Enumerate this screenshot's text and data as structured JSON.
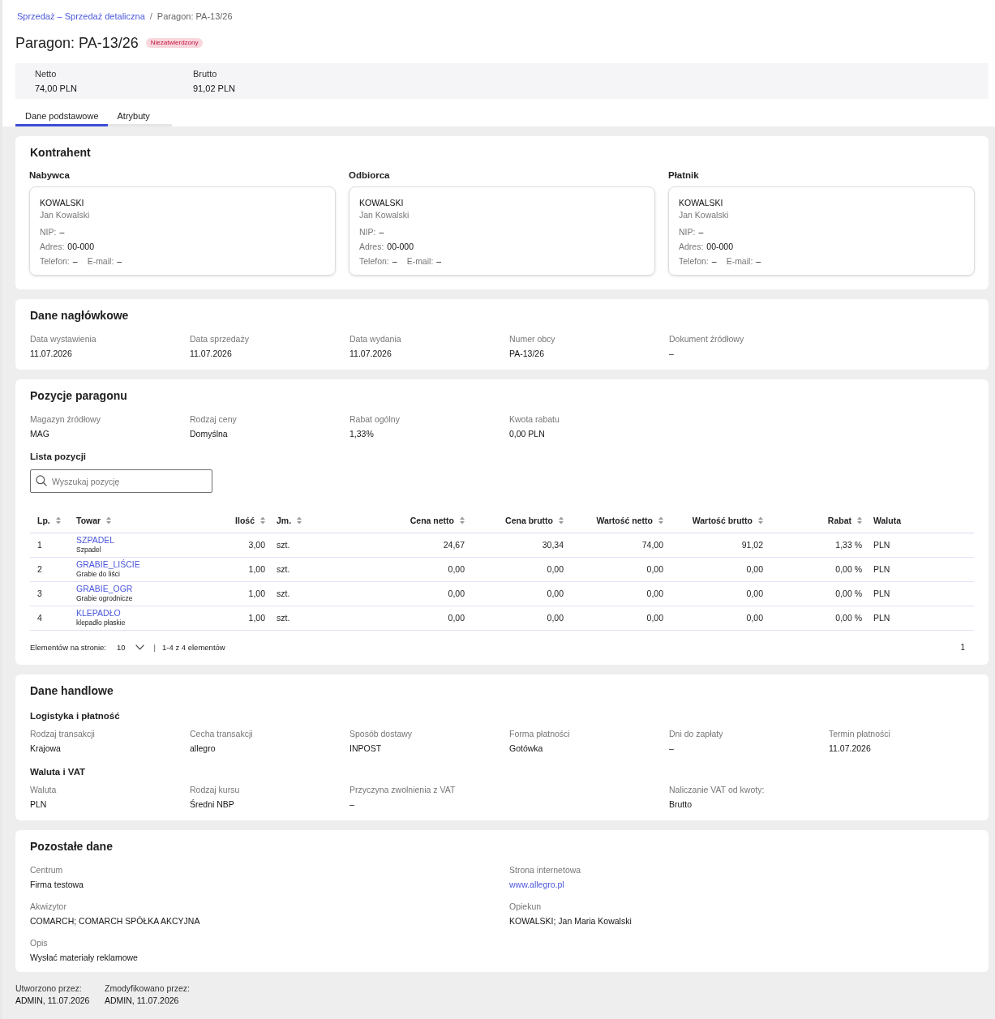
{
  "breadcrumb": {
    "items": [
      {
        "label": "Sprzedaż – Sprzedaż detaliczna",
        "kind": "link"
      },
      {
        "label": "Paragon: PA-13/26",
        "kind": "current"
      }
    ],
    "separator": "/"
  },
  "title": "Paragon: PA-13/26",
  "status_badge": "Niezatwierdzony",
  "summary": [
    {
      "label": "Netto",
      "value": "74,00 PLN"
    },
    {
      "label": "Brutto",
      "value": "91,02 PLN"
    }
  ],
  "tabs": [
    {
      "label": "Dane podstawowe",
      "selected": true
    },
    {
      "label": "Atrybuty",
      "selected": false
    }
  ],
  "kontrahent": {
    "title": "Kontrahent",
    "parties": [
      {
        "role": "Nabywca",
        "code": "KOWALSKI",
        "name": "Jan Kowalski",
        "lines": [
          [
            {
              "label": "NIP:",
              "value": "–"
            }
          ],
          [
            {
              "label": "Adres:",
              "value": "00-000"
            }
          ],
          [
            {
              "label": "Telefon:",
              "value": "–"
            },
            {
              "label": "E-mail:",
              "value": "–"
            }
          ]
        ]
      },
      {
        "role": "Odbiorca",
        "code": "KOWALSKI",
        "name": "Jan Kowalski",
        "lines": [
          [
            {
              "label": "NIP:",
              "value": "–"
            }
          ],
          [
            {
              "label": "Adres:",
              "value": "00-000"
            }
          ],
          [
            {
              "label": "Telefon:",
              "value": "–"
            },
            {
              "label": "E-mail:",
              "value": "–"
            }
          ]
        ]
      },
      {
        "role": "Płatnik",
        "code": "KOWALSKI",
        "name": "Jan Kowalski",
        "lines": [
          [
            {
              "label": "NIP:",
              "value": "–"
            }
          ],
          [
            {
              "label": "Adres:",
              "value": "00-000"
            }
          ],
          [
            {
              "label": "Telefon:",
              "value": "–"
            },
            {
              "label": "E-mail:",
              "value": "–"
            }
          ]
        ]
      }
    ]
  },
  "header_data": {
    "title": "Dane nagłówkowe",
    "fields": [
      {
        "label": "Data wystawienia",
        "value": "11.07.2026"
      },
      {
        "label": "Data sprzedaży",
        "value": "11.07.2026"
      },
      {
        "label": "Data wydania",
        "value": "11.07.2026"
      },
      {
        "label": "Numer obcy",
        "value": "PA-13/26"
      },
      {
        "label": "Dokument źródłowy",
        "value": "–"
      }
    ]
  },
  "positions": {
    "title": "Pozycje paragonu",
    "fields": [
      {
        "label": "Magazyn źródłowy",
        "value": "MAG"
      },
      {
        "label": "Rodzaj ceny",
        "value": "Domyślna"
      },
      {
        "label": "Rabat ogólny",
        "value": "1,33%"
      },
      {
        "label": "Kwota rabatu",
        "value": "0,00 PLN"
      }
    ],
    "list_title": "Lista pozycji",
    "search": {
      "placeholder": "Wyszukaj pozycję"
    },
    "table": {
      "columns": [
        {
          "label": "Lp.",
          "kind": "index",
          "sortable": true
        },
        {
          "label": "Towar",
          "kind": "product",
          "sortable": true
        },
        {
          "label": "Ilość",
          "kind": "number",
          "sortable": true
        },
        {
          "label": "Jm.",
          "kind": "text",
          "sortable": true
        },
        {
          "label": "Cena netto",
          "kind": "number",
          "sortable": true
        },
        {
          "label": "Cena brutto",
          "kind": "number",
          "sortable": true
        },
        {
          "label": "Wartość netto",
          "kind": "number",
          "sortable": true
        },
        {
          "label": "Wartość brutto",
          "kind": "number",
          "sortable": true
        },
        {
          "label": "Rabat",
          "kind": "number",
          "sortable": true
        },
        {
          "label": "Waluta",
          "kind": "text",
          "sortable": false
        }
      ],
      "rows": [
        {
          "lp": "1",
          "code": "SZPADEL",
          "name": "Szpadel",
          "values": [
            "3,00",
            "szt.",
            "24,67",
            "30,34",
            "74,00",
            "91,02",
            "1,33 %",
            "PLN"
          ]
        },
        {
          "lp": "2",
          "code": "GRABIE_LIŚCIE",
          "name": "Grabie do liści",
          "values": [
            "1,00",
            "szt.",
            "0,00",
            "0,00",
            "0,00",
            "0,00",
            "0,00 %",
            "PLN"
          ]
        },
        {
          "lp": "3",
          "code": "GRABIE_OGR",
          "name": "Grabie ogrodnicze",
          "values": [
            "1,00",
            "szt.",
            "0,00",
            "0,00",
            "0,00",
            "0,00",
            "0,00 %",
            "PLN"
          ]
        },
        {
          "lp": "4",
          "code": "KLEPADŁO",
          "name": "klepadło płaskie",
          "values": [
            "1,00",
            "szt.",
            "0,00",
            "0,00",
            "0,00",
            "0,00",
            "0,00 %",
            "PLN"
          ]
        }
      ]
    },
    "pagination": {
      "page_size_label": "Elementów na stronie:",
      "page_size": "10",
      "separator": "|",
      "range": "1-4 z 4 elementów",
      "current_page": "1"
    }
  },
  "trade_data": {
    "title": "Dane handlowe",
    "groups": [
      {
        "title": "Logistyka i płatność",
        "fields": [
          {
            "label": "Rodzaj transakcji",
            "value": "Krajowa"
          },
          {
            "label": "Cecha transakcji",
            "value": "allegro"
          },
          {
            "label": "Sposób dostawy",
            "value": "INPOST"
          },
          {
            "label": "Forma płatności",
            "value": "Gotówka"
          },
          {
            "label": "Dni do zapłaty",
            "value": "–"
          },
          {
            "label": "Termin płatności",
            "value": "11.07.2026"
          }
        ]
      },
      {
        "title": "Waluta i VAT",
        "fields": [
          {
            "label": "Waluta",
            "value": "PLN"
          },
          {
            "label": "Rodzaj kursu",
            "value": "Średni NBP"
          },
          {
            "label": "Przyczyna zwolnienia z VAT",
            "value": "–"
          }
        ],
        "extra_field": {
          "label": "Naliczanie VAT od kwoty:",
          "value": "Brutto"
        }
      }
    ]
  },
  "other_data": {
    "title": "Pozostałe dane",
    "columns": [
      [
        {
          "label": "Centrum",
          "value": "Firma testowa",
          "kind": "text"
        },
        {
          "label": "Akwizytor",
          "value": "COMARCH; COMARCH SPÓŁKA AKCYJNA",
          "kind": "text"
        },
        {
          "label": "Opis",
          "value": "Wysłać materiały reklamowe",
          "kind": "text"
        }
      ],
      [
        {
          "label": "Strona internetowa",
          "value": "www.allegro.pl",
          "kind": "link"
        },
        {
          "label": "Opiekun",
          "value": "KOWALSKI; Jan Maria Kowalski",
          "kind": "text"
        }
      ]
    ]
  },
  "footer": [
    {
      "label": "Utworzono przez:",
      "value": "ADMIN, 11.07.2026"
    },
    {
      "label": "Zmodyfikowano przez:",
      "value": "ADMIN, 11.07.2026"
    }
  ]
}
